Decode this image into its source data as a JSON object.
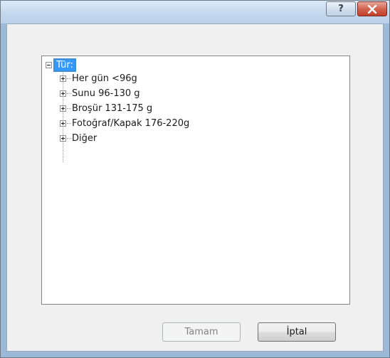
{
  "titlebar": {
    "help_glyph": "?",
    "help_icon": "question-mark-icon",
    "close_icon": "close-x-icon"
  },
  "tree": {
    "root": {
      "label": "Tür:",
      "expanded": true
    },
    "children": [
      {
        "label": "Her gün <96g",
        "expanded": false
      },
      {
        "label": "Sunu 96-130 g",
        "expanded": false
      },
      {
        "label": "Broşür 131-175 g",
        "expanded": false
      },
      {
        "label": "Fotoğraf/Kapak 176-220g",
        "expanded": false
      },
      {
        "label": "Diğer",
        "expanded": false
      }
    ]
  },
  "buttons": {
    "ok_label": "Tamam",
    "ok_enabled": false,
    "cancel_label": "İptal"
  },
  "colors": {
    "selection": "#3399ff",
    "frame": "#9db9d8",
    "client": "#f0f0f0",
    "close_button": "#c94a36"
  }
}
